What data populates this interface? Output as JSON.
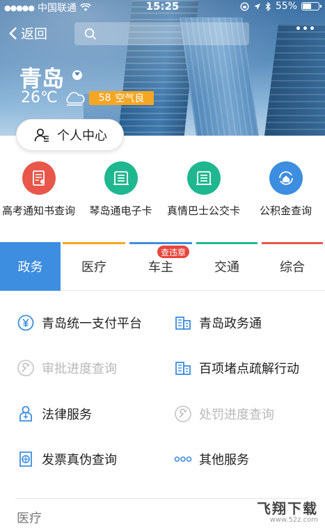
{
  "status_bar": {
    "carrier": "中国联通",
    "time": "15:25",
    "battery": "55%",
    "battery_level": 0.55
  },
  "nav": {
    "back_label": "返回",
    "search_placeholder": ""
  },
  "weather": {
    "city": "青岛",
    "temperature": "26℃",
    "aqi_value": "58",
    "aqi_label": "空气良",
    "aqi_color": "#f5a623"
  },
  "personal_center": {
    "label": "个人中心"
  },
  "shortcuts": [
    {
      "label": "高考通知书查询",
      "icon": "document-icon",
      "color": "#e8574a"
    },
    {
      "label": "琴岛通电子卡",
      "icon": "card-icon",
      "color": "#1fb78f"
    },
    {
      "label": "真情巴士公交卡",
      "icon": "card-icon",
      "color": "#1fb78f"
    },
    {
      "label": "公积金查询",
      "icon": "house-refresh-icon",
      "color": "#3d8de0"
    }
  ],
  "tabs": [
    {
      "label": "政务",
      "active": true,
      "bar_color": "#3d8de0"
    },
    {
      "label": "医疗",
      "active": false,
      "bar_color": "#f5a623"
    },
    {
      "label": "车主",
      "active": false,
      "bar_color": "#3d8de0"
    },
    {
      "label": "交通",
      "active": false,
      "bar_color": "#1fb78f"
    },
    {
      "label": "综合",
      "active": false,
      "bar_color": "#e8574a"
    }
  ],
  "tab_badge": "查违章",
  "services": [
    {
      "label": "青岛统一支付平台",
      "icon": "yuan-icon",
      "enabled": true
    },
    {
      "label": "青岛政务通",
      "icon": "building-icon",
      "enabled": true
    },
    {
      "label": "审批进度查询",
      "icon": "wrench-icon",
      "enabled": false
    },
    {
      "label": "百项堵点疏解行动",
      "icon": "building-icon",
      "enabled": true
    },
    {
      "label": "法律服务",
      "icon": "lawyer-icon",
      "enabled": true
    },
    {
      "label": "处罚进度查询",
      "icon": "wrench-icon",
      "enabled": false
    },
    {
      "label": "发票真伪查询",
      "icon": "invoice-globe-icon",
      "enabled": true
    },
    {
      "label": "其他服务",
      "icon": "more-dots-icon",
      "enabled": true
    }
  ],
  "next_section_title": "医疗",
  "watermark": {
    "main": "飞翔下载",
    "sub": "www.52z.com"
  },
  "colors": {
    "primary": "#3d8de0",
    "disabled": "#b8b8b8"
  }
}
